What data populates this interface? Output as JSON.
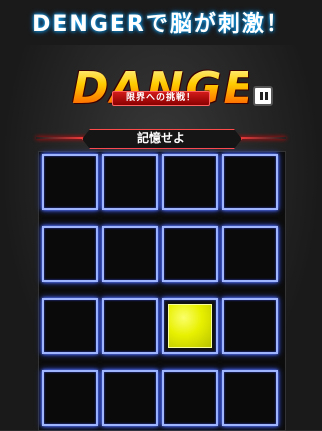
{
  "header": {
    "title": "DENGERで脳が刺激！"
  },
  "logo": {
    "title": "DANGER",
    "tagline": "限界への挑戦！"
  },
  "instruction": {
    "label": "記憶せよ"
  },
  "board": {
    "rows": 4,
    "cols": 4,
    "lit_cells": [
      {
        "row": 3,
        "col": 3
      }
    ]
  },
  "colors": {
    "cell_border": "#9fb6ff",
    "lit_cell": "#e8f000",
    "accent_red": "#ff3a3a"
  },
  "icons": {
    "pause": "pause-icon"
  }
}
